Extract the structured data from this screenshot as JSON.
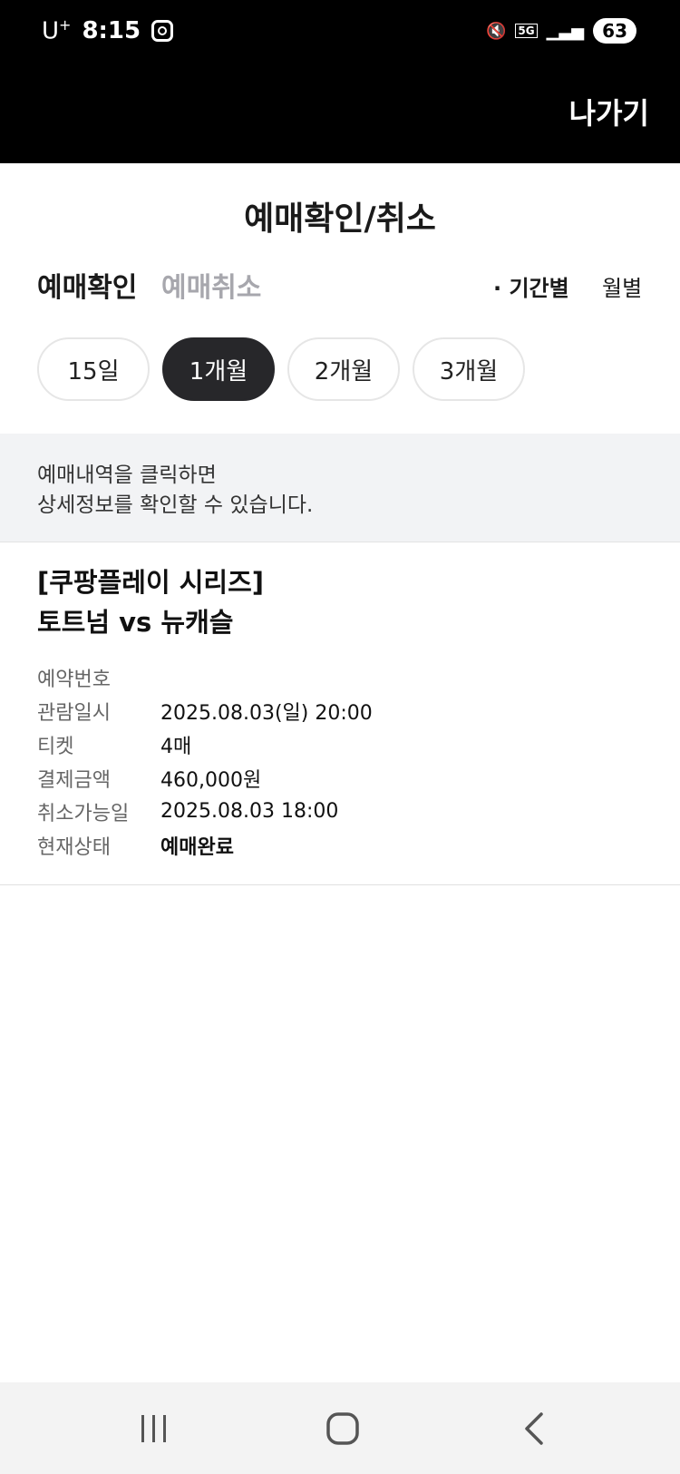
{
  "status_bar": {
    "carrier": "U",
    "carrier_sup": "+",
    "time": "8:15",
    "network": "5G",
    "battery": "63"
  },
  "header": {
    "exit_label": "나가기"
  },
  "page": {
    "title": "예매확인/취소"
  },
  "tabs": [
    {
      "label": "예매확인",
      "active": true
    },
    {
      "label": "예매취소",
      "active": false
    }
  ],
  "filters": [
    {
      "label": "· 기간별",
      "active": true
    },
    {
      "label": "월별",
      "active": false
    }
  ],
  "periods": [
    {
      "label": "15일",
      "selected": false
    },
    {
      "label": "1개월",
      "selected": true
    },
    {
      "label": "2개월",
      "selected": false
    },
    {
      "label": "3개월",
      "selected": false
    }
  ],
  "notice": {
    "line1": "예매내역을 클릭하면",
    "line2": "상세정보를 확인할 수 있습니다."
  },
  "booking": {
    "title_line1": "[쿠팡플레이 시리즈]",
    "title_line2": "토트넘 vs 뉴캐슬",
    "details": [
      {
        "label": "예약번호",
        "value": ""
      },
      {
        "label": "관람일시",
        "value": "2025.08.03(일) 20:00"
      },
      {
        "label": "티켓",
        "value": "4매"
      },
      {
        "label": "결제금액",
        "value": "460,000원"
      },
      {
        "label": "취소가능일",
        "value": "2025.08.03 18:00"
      },
      {
        "label": "현재상태",
        "value": "예매완료"
      }
    ]
  },
  "nav": {
    "recents": "recents-icon",
    "home": "home-icon",
    "back": "back-icon"
  }
}
